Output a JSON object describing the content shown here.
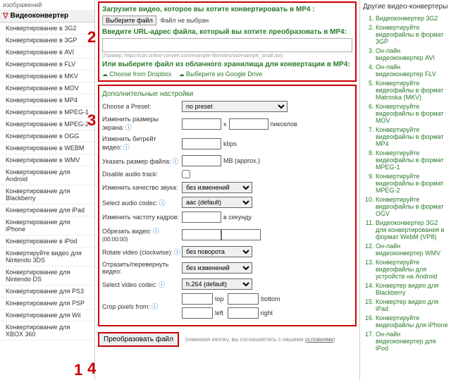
{
  "left": {
    "header": "изображений",
    "title": "Видеоконвертер",
    "items": [
      "Конвертирование в 3G2",
      "Конвертирование в 3GP",
      "Конвертирование в AVI",
      "Конвертирование в FLV",
      "Конвертирование в MKV",
      "Конвертирование в MOV",
      "Конвертирование в MP4",
      "Конвертирование в MPEG-1",
      "Конвертирование в MPEG-2",
      "Конвертирование в OGG",
      "Конвертирование в WEBM",
      "Конвертирование в WMV",
      "Конвертирование для Android",
      "Конвертирование для Blackberry",
      "Конвертирование для iPad",
      "Конвертирование для iPhone",
      "Конвертирование в iPod",
      "Конвертируйте видео для Nintendo 3DS",
      "Конвертирование для Nintendo DS",
      "Конвертирование для PS3",
      "Конвертирование для PSP",
      "Конвертирование для Wii",
      "Конвертирование для XBOX 360"
    ]
  },
  "upload": {
    "title1": "Загрузите видео, которое вы хотите конвертировать в MP4 :",
    "chooseBtn": "Выберите файл",
    "noFile": "Файл не выбран",
    "title2": "Введите URL-адрес файла, который вы хотите преобразовать в MP4:",
    "hint": "(Пример: https://cdn.online-convert.com/example-file/video/avi/example_small.avi)",
    "title3": "Или выберите файл из облачного хранилища для конвертации в MP4:",
    "dropbox": "Choose from Dropbox",
    "gdrive": "Выберите из Google Drive"
  },
  "settings": {
    "hdr": "Дополнительные настройки",
    "preset": "Choose a Preset:",
    "presetVal": "no preset",
    "size": "Изменить размеры экрана:",
    "x": "x",
    "px": "пикселов",
    "bitrate": "Изменить битрейт видео:",
    "kbps": "kbps",
    "filesize": "Указать размер файла:",
    "mb": "MB (approx.)",
    "disaudio": "Disable audio track:",
    "aquality": "Изменить качество звука:",
    "aqualVal": "без изменений",
    "acodec": "Select audio codec:",
    "acodecVal": "aac (default)",
    "fps": "Изменить частоту кадров:",
    "fpsunit": "в секунду",
    "trim": "Обрезать видео:",
    "trimhint": "(00:00:00)",
    "rotate": "Rotate video (clockwise):",
    "rotateVal": "без поворота",
    "flip": "Отразить/перевернуть видео:",
    "flipVal": "без изменений",
    "vcodec": "Select video codec:",
    "vcodecVal": "h.264 (default)",
    "crop": "Crop pixels from:",
    "top": "top",
    "bottom": "bottom",
    "left": "left",
    "right": "right"
  },
  "convert": {
    "btn": "Преобразовать файл",
    "terms1": "(нажимая кнопку, вы соглашаетесь с нашими ",
    "terms2": "условиями",
    ")": ")"
  },
  "right": {
    "hdr": "Другие видео-конвертеры",
    "items": [
      "Видеоконвертер 3G2",
      "Конвертируйте видеофайлы в формат 3GP",
      "Он-лайн видеоконвертер AVI",
      "Он-лайн видеоконвертер FLV",
      "Конвертируйте видеофайлы в формат Matroska (MKV)",
      "Конвертируйте видеофайлы в формат MOV",
      "Конвертируйте видеофайлы в формат MP4",
      "Конвертируйте видеофайлы в формат MPEG-1",
      "Конвертируйте видеофайлы в формат MPEG-2",
      "Конвертируйте видеофайлы в формат OGV",
      "Видеоконвертер 3G2 для конвертирования в формат WebM (VP8)",
      "Он-лайн видеоконвертер WMV",
      "Конвертируйте видеофайлы для устройств на Android",
      "Конвертер видео для Blackberry",
      "Конвертер видео для iPad",
      "Конвертируйте видеофайлы для iPhone",
      "Он-лайн видеоконвертер для iPod"
    ]
  },
  "nums": {
    "n1": "1",
    "n2": "2",
    "n3": "3",
    "n4": "4"
  }
}
